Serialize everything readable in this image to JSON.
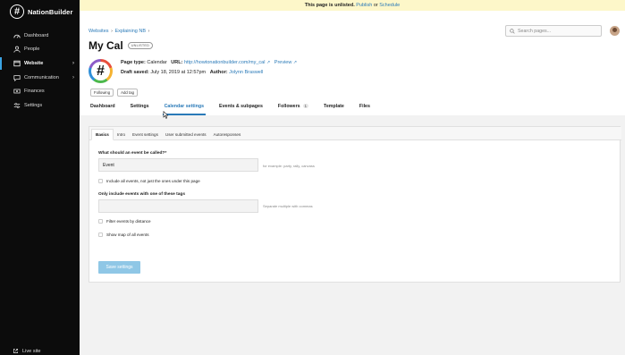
{
  "sidebar": {
    "brand": "NationBuilder",
    "brand_logo": "#",
    "items": [
      {
        "label": "Dashboard",
        "icon": "dashboard-icon"
      },
      {
        "label": "People",
        "icon": "people-icon"
      },
      {
        "label": "Website",
        "icon": "website-icon",
        "active": true
      },
      {
        "label": "Communication",
        "icon": "communication-icon"
      },
      {
        "label": "Finances",
        "icon": "finances-icon"
      },
      {
        "label": "Settings",
        "icon": "settings-icon"
      }
    ],
    "chevron": "›",
    "live_site": "Live site"
  },
  "banner": {
    "text": "This page is unlisted.",
    "publish": "Publish",
    "or": "or",
    "schedule": "Schedule"
  },
  "breadcrumb": {
    "websites": "Websites",
    "explaining": "Explaining NB",
    "sep": "›"
  },
  "search": {
    "placeholder": "Search pages..."
  },
  "page": {
    "title": "My Cal",
    "badge": "UNLISTED",
    "logo": "#",
    "page_type_label": "Page type:",
    "page_type": "Calendar",
    "url_label": "URL:",
    "url": "http://howtonationbuilder.com/my_cal",
    "preview": "Preview",
    "draft_label": "Draft saved:",
    "draft_date": "July 18, 2019 at 12:57pm",
    "author_label": "Author:",
    "author": "Jolynn Braswell"
  },
  "pills": {
    "following": "Following",
    "add_tag": "Add tag"
  },
  "tabs": [
    {
      "label": "Dashboard"
    },
    {
      "label": "Settings"
    },
    {
      "label": "Calendar settings",
      "active": true
    },
    {
      "label": "Events & subpages"
    },
    {
      "label": "Followers",
      "count": "1"
    },
    {
      "label": "Template"
    },
    {
      "label": "Files"
    }
  ],
  "sub_tabs": [
    {
      "label": "Basics",
      "active": true
    },
    {
      "label": "Intro"
    },
    {
      "label": "Event settings"
    },
    {
      "label": "User submitted events"
    },
    {
      "label": "Autoresponses"
    }
  ],
  "form": {
    "event_called_label": "What should an event be called?*",
    "event_called_value": "Event",
    "event_called_hint": "for example: party, rally, canvass",
    "include_all_label": "Include all events, not just the ones under this page",
    "tags_label": "Only include events with one of these tags",
    "tags_value": "",
    "tags_hint": "Separate multiple with commas",
    "filter_distance_label": "Filter events by distance",
    "show_map_label": "Show map of all events",
    "save_label": "Save settings"
  },
  "colors": {
    "sidebar_bg": "#0c0c0c",
    "accent": "#2a7ab8",
    "banner_bg": "#fdf7c9",
    "save_button": "#8fc7e6"
  }
}
